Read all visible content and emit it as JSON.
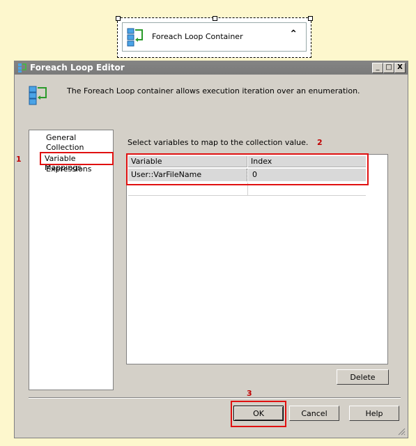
{
  "container": {
    "title": "Foreach Loop Container",
    "collapse_glyph": "⌃"
  },
  "window": {
    "title": "Foreach Loop Editor",
    "buttons": {
      "minimize": "_",
      "maximize": "□",
      "close": "X"
    },
    "description": "The Foreach Loop container allows execution iteration over an enumeration."
  },
  "nav": {
    "items": [
      "General",
      "Collection",
      "Variable Mappings",
      "Expressions"
    ],
    "selected": "Variable Mappings"
  },
  "main": {
    "intro": "Select variables to map to the collection value.",
    "columns": [
      "Variable",
      "Index"
    ],
    "rows": [
      {
        "variable": "User::VarFileName",
        "index": "0"
      }
    ]
  },
  "actions": {
    "delete": "Delete",
    "ok": "OK",
    "cancel": "Cancel",
    "help": "Help"
  },
  "annotations": {
    "n1": "1",
    "n2": "2",
    "n3": "3"
  },
  "colors": {
    "accent_red": "#e01010",
    "title_bar": "#7f7f7f",
    "dialog_bg": "#d4d0c8",
    "page_bg": "#fdf7cd"
  }
}
